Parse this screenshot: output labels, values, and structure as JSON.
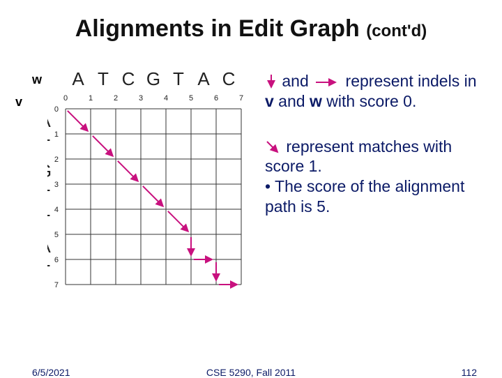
{
  "title_main": "Alignments in Edit Graph ",
  "title_cont": "(cont'd)",
  "w_label": "w",
  "v_label": "v",
  "w_seq": [
    "A",
    "T",
    "C",
    "G",
    "T",
    "A",
    "C"
  ],
  "v_seq": [
    "A",
    "T",
    "G",
    "T",
    "T",
    "A",
    "T"
  ],
  "col_nums": [
    "0",
    "1",
    "2",
    "3",
    "4",
    "5",
    "6",
    "7"
  ],
  "row_nums": [
    "0",
    "1",
    "2",
    "3",
    "4",
    "5",
    "6",
    "7"
  ],
  "expl": {
    "and": "and",
    "repr1a": "represent",
    "repr1b": "indels in ",
    "v": "v",
    "andword": " and ",
    "w": "w",
    "with0": " with score 0.",
    "repr2a": "represent matches with score 1.",
    "repr2b": "• The score of the alignment path is 5."
  },
  "footer": {
    "date": "6/5/2021",
    "course": "CSE 5290, Fall 2011",
    "page": "112"
  },
  "chart_data": {
    "type": "table",
    "description": "7x7 edit graph grid; path from (0,0) to (7,7). Diagonal arrows = match (score 1). Vertical/horizontal arrows = indel (score 0). Alignment path score = 5.",
    "w_seq": [
      "A",
      "T",
      "C",
      "G",
      "T",
      "A",
      "C"
    ],
    "v_seq": [
      "A",
      "T",
      "G",
      "T",
      "T",
      "A",
      "T"
    ],
    "path_edges": [
      {
        "from": [
          0,
          0
        ],
        "to": [
          1,
          1
        ],
        "type": "diag"
      },
      {
        "from": [
          1,
          1
        ],
        "to": [
          2,
          2
        ],
        "type": "diag"
      },
      {
        "from": [
          2,
          2
        ],
        "to": [
          3,
          3
        ],
        "type": "diag"
      },
      {
        "from": [
          3,
          3
        ],
        "to": [
          4,
          4
        ],
        "type": "diag"
      },
      {
        "from": [
          4,
          4
        ],
        "to": [
          5,
          5
        ],
        "type": "diag"
      },
      {
        "from": [
          5,
          5
        ],
        "to": [
          6,
          5
        ],
        "type": "down"
      },
      {
        "from": [
          6,
          5
        ],
        "to": [
          6,
          6
        ],
        "type": "right"
      },
      {
        "from": [
          6,
          6
        ],
        "to": [
          7,
          6
        ],
        "type": "down"
      },
      {
        "from": [
          7,
          6
        ],
        "to": [
          7,
          7
        ],
        "type": "right"
      }
    ],
    "path_score": 5
  }
}
